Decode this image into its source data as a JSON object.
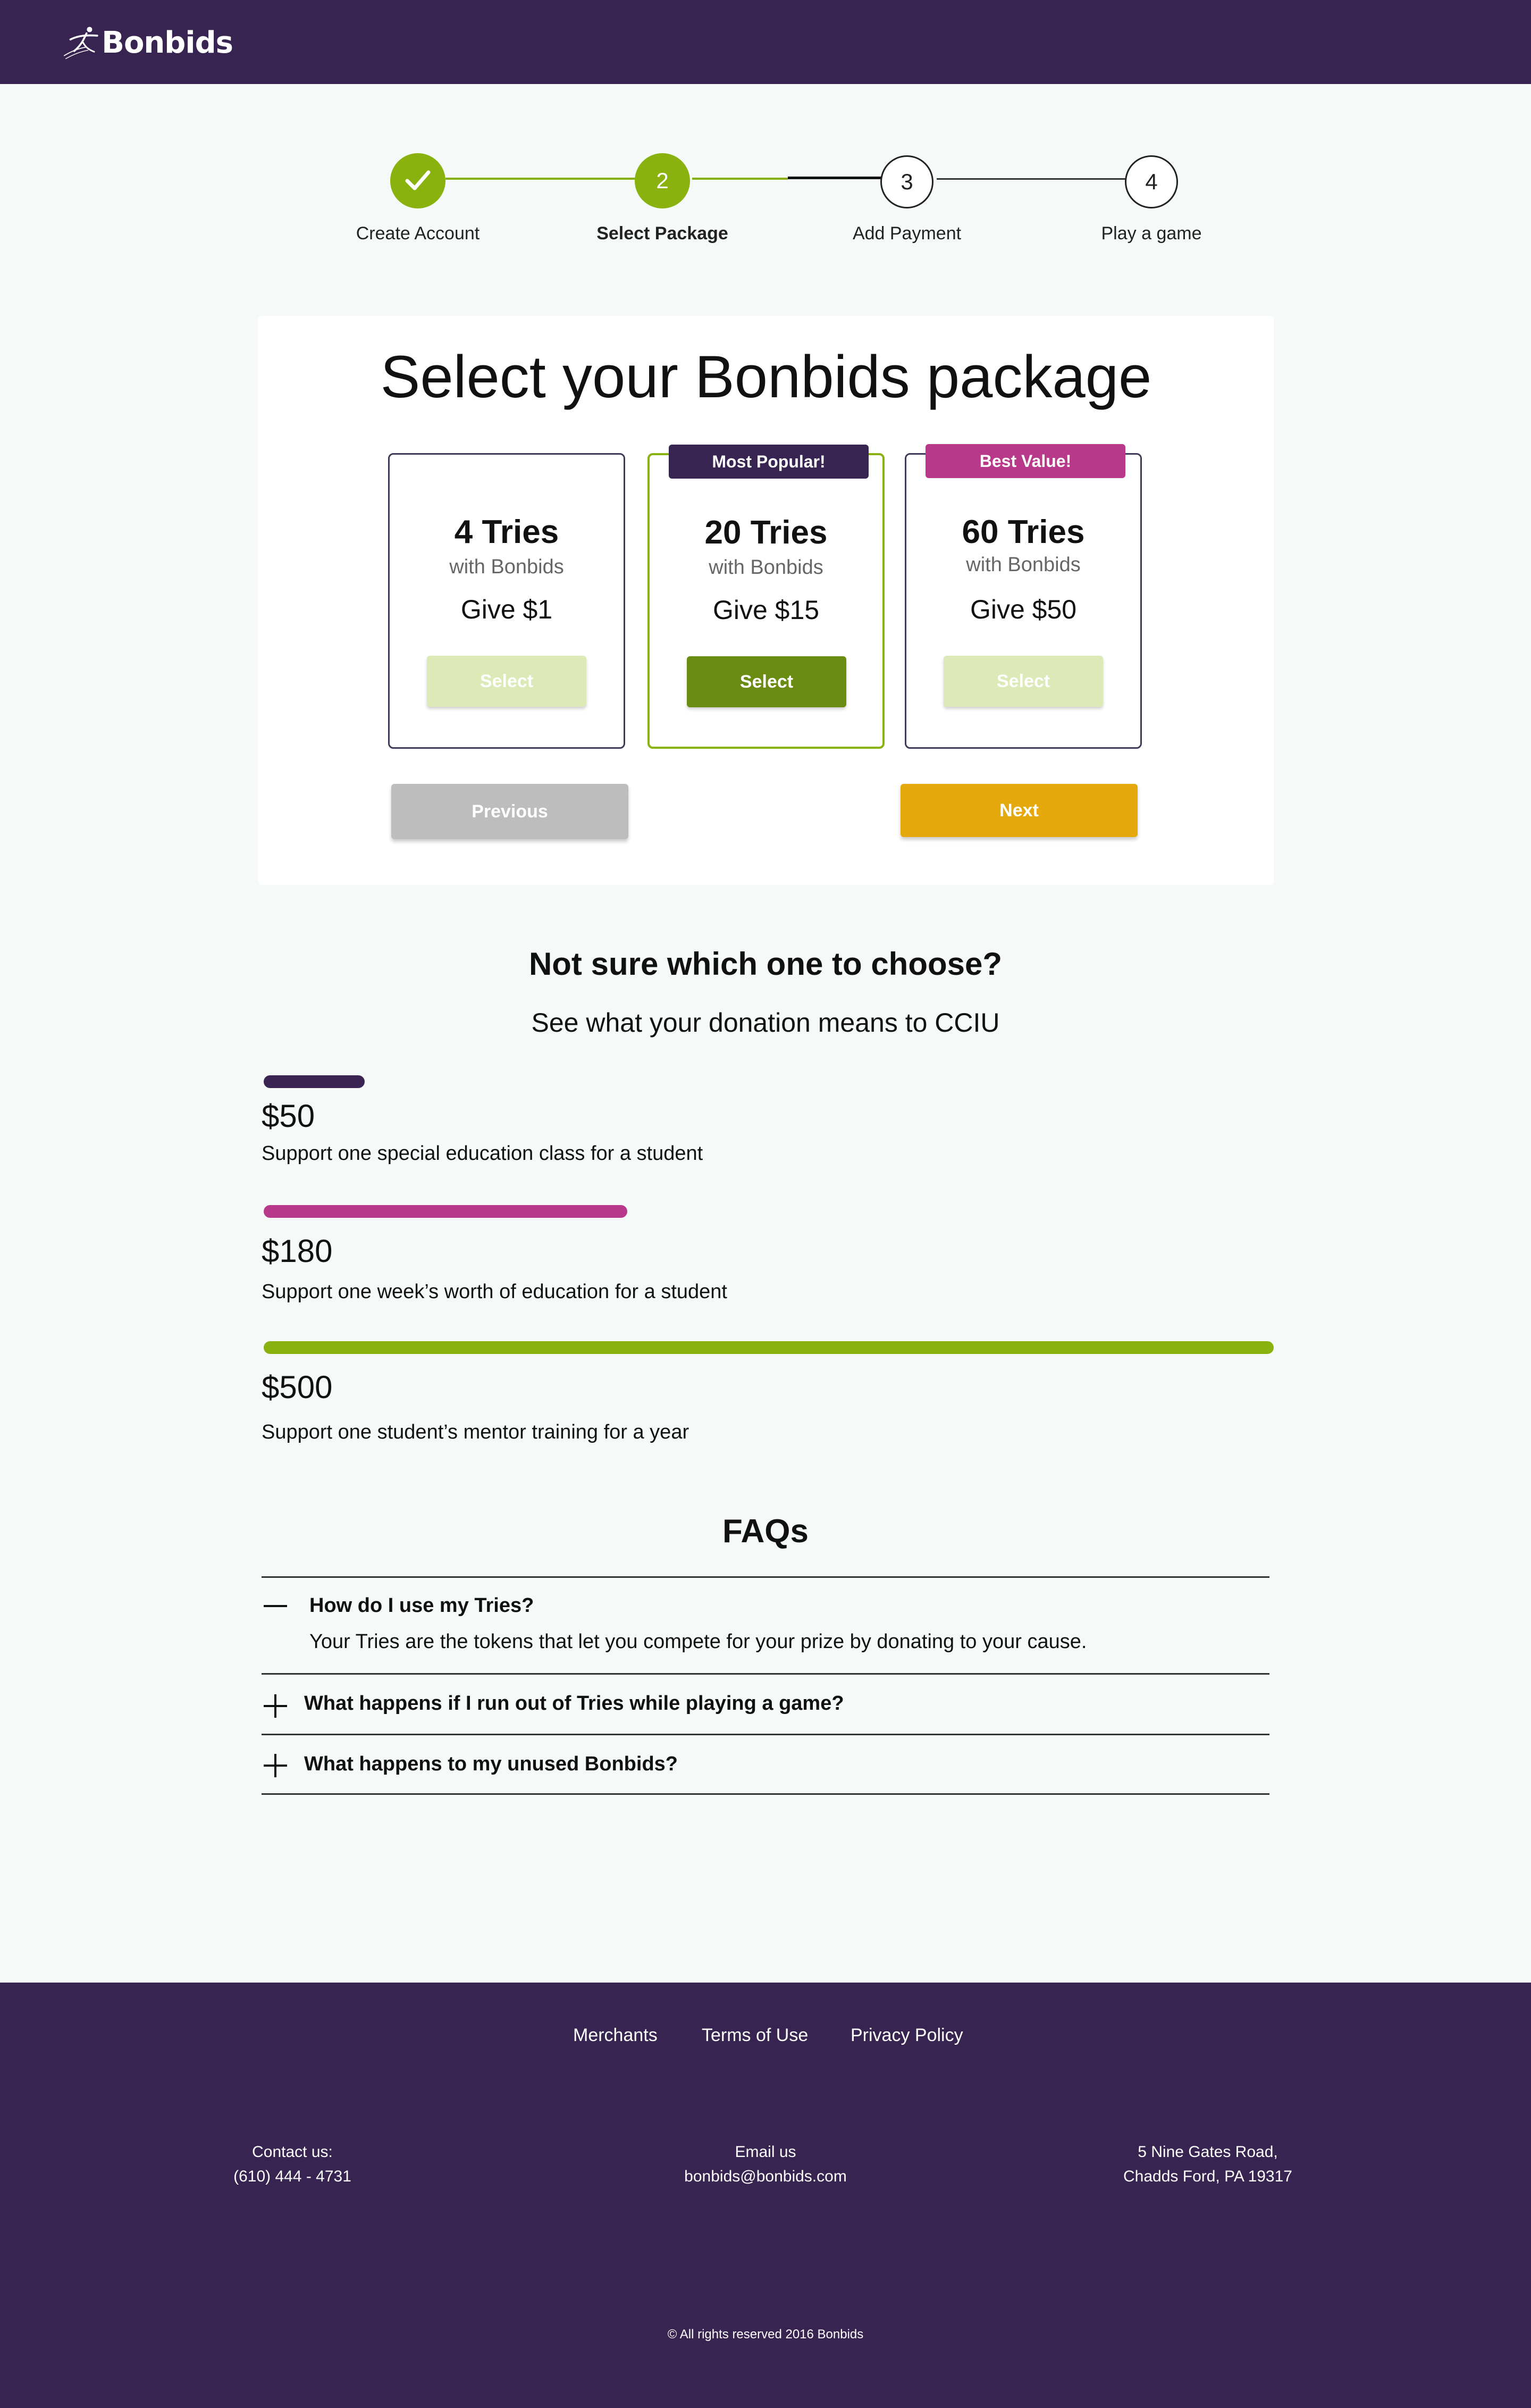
{
  "header": {
    "logo_text": "Bonbids"
  },
  "stepper": {
    "steps": [
      {
        "label": "Create Account",
        "number": "",
        "state": "done"
      },
      {
        "label": "Select Package",
        "number": "2",
        "state": "active"
      },
      {
        "label": "Add Payment",
        "number": "3",
        "state": "todo"
      },
      {
        "label": "Play a game",
        "number": "4",
        "state": "todo"
      }
    ]
  },
  "packages": {
    "title": "Select your Bonbids package",
    "items": [
      {
        "tries": "4 Tries",
        "with": "with Bonbids",
        "give": "Give $1",
        "select_label": "Select",
        "badge": "",
        "selected": false
      },
      {
        "tries": "20 Tries",
        "with": "with Bonbids",
        "give": "Give $15",
        "select_label": "Select",
        "badge": "Most Popular!",
        "selected": true
      },
      {
        "tries": "60 Tries",
        "with": "with Bonbids",
        "give": "Give $50",
        "select_label": "Select",
        "badge": "Best Value!",
        "selected": false
      }
    ],
    "previous_label": "Previous",
    "next_label": "Next"
  },
  "donation": {
    "heading": "Not sure which one to choose?",
    "subheading": "See what your donation means to CCIU",
    "items": [
      {
        "amount": "$50",
        "description": "Support one special education class for a student",
        "fraction": 0.1,
        "color": "#3a2452"
      },
      {
        "amount": "$180",
        "description": "Support one week’s worth of education for a student",
        "fraction": 0.36,
        "color": "#b8388a"
      },
      {
        "amount": "$500",
        "description": "Support one student’s mentor training for a year",
        "fraction": 1.0,
        "color": "#8ab20f"
      }
    ]
  },
  "faq": {
    "heading": "FAQs",
    "items": [
      {
        "question": "How do I use my Tries?",
        "answer": "Your Tries are the tokens that let you compete for your prize by donating to your cause.",
        "expanded": true
      },
      {
        "question": "What happens if I run out of Tries while playing a game?",
        "answer": "",
        "expanded": false
      },
      {
        "question": "What happens to my unused Bonbids?",
        "answer": "",
        "expanded": false
      }
    ]
  },
  "footer": {
    "links": [
      "Merchants",
      "Terms of Use",
      "Privacy Policy"
    ],
    "contact_label": "Contact us:",
    "contact_phone": "(610) 444 - 4731",
    "email_label": "Email us",
    "email": "bonbids@bonbids.com",
    "address_line1": "5 Nine Gates Road,",
    "address_line2": "Chadds Ford, PA 19317",
    "copyright": "© All rights reserved 2016 Bonbids"
  },
  "colors": {
    "brand_purple": "#372450",
    "accent_green": "#8ab20f",
    "select_active": "#6b8c13",
    "select_inactive": "#dde9b7",
    "badge_popular": "#372450",
    "badge_value": "#b8388a",
    "previous_button": "#bdbdbd",
    "next_button": "#e5a90d"
  }
}
